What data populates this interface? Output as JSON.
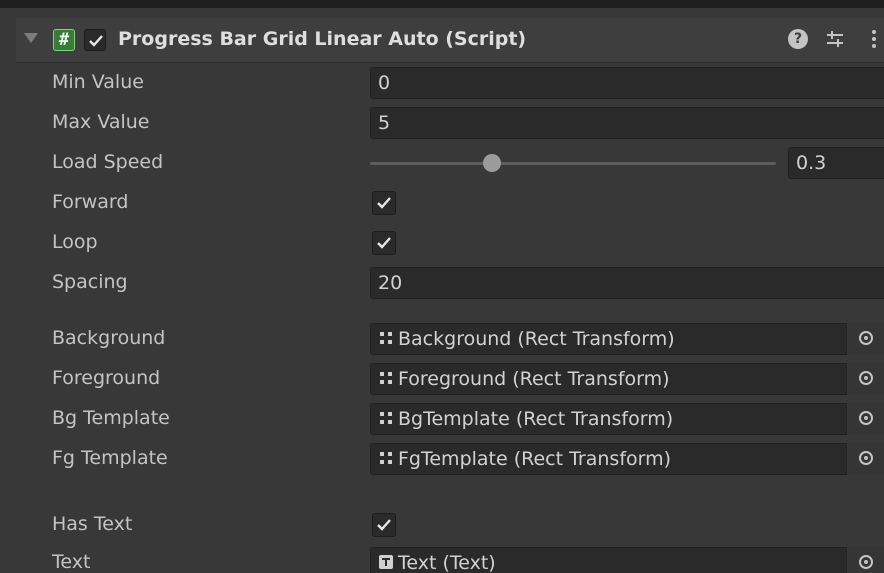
{
  "header": {
    "title": "Progress Bar Grid Linear Auto (Script)",
    "script_icon_glyph": "#",
    "enabled": true,
    "icons": [
      "foldout-arrow-icon",
      "script-icon",
      "help-icon",
      "preset-icon",
      "context-menu-icon"
    ],
    "help_glyph": "?"
  },
  "fields": {
    "min_value": {
      "label": "Min Value",
      "value": "0"
    },
    "max_value": {
      "label": "Max Value",
      "value": "5"
    },
    "load_speed": {
      "label": "Load Speed",
      "value": "0.3",
      "fraction": 0.3
    },
    "forward": {
      "label": "Forward",
      "checked": true
    },
    "loop": {
      "label": "Loop",
      "checked": true
    },
    "spacing": {
      "label": "Spacing",
      "value": "20"
    },
    "background": {
      "label": "Background",
      "value": "Background (Rect Transform)",
      "icon": "rect-transform-icon"
    },
    "foreground": {
      "label": "Foreground",
      "value": "Foreground (Rect Transform)",
      "icon": "rect-transform-icon"
    },
    "bg_template": {
      "label": "Bg Template",
      "value": "BgTemplate (Rect Transform)",
      "icon": "rect-transform-icon"
    },
    "fg_template": {
      "label": "Fg Template",
      "value": "FgTemplate (Rect Transform)",
      "icon": "rect-transform-icon"
    },
    "has_text": {
      "label": "Has Text",
      "checked": true
    },
    "text": {
      "label": "Text",
      "value": "Text (Text)",
      "icon": "text-component-icon"
    }
  },
  "colors": {
    "background": "#383838",
    "field": "#2a2a2a",
    "label_text": "#c4c4c4",
    "script_icon_green": "#3c7a3c"
  }
}
